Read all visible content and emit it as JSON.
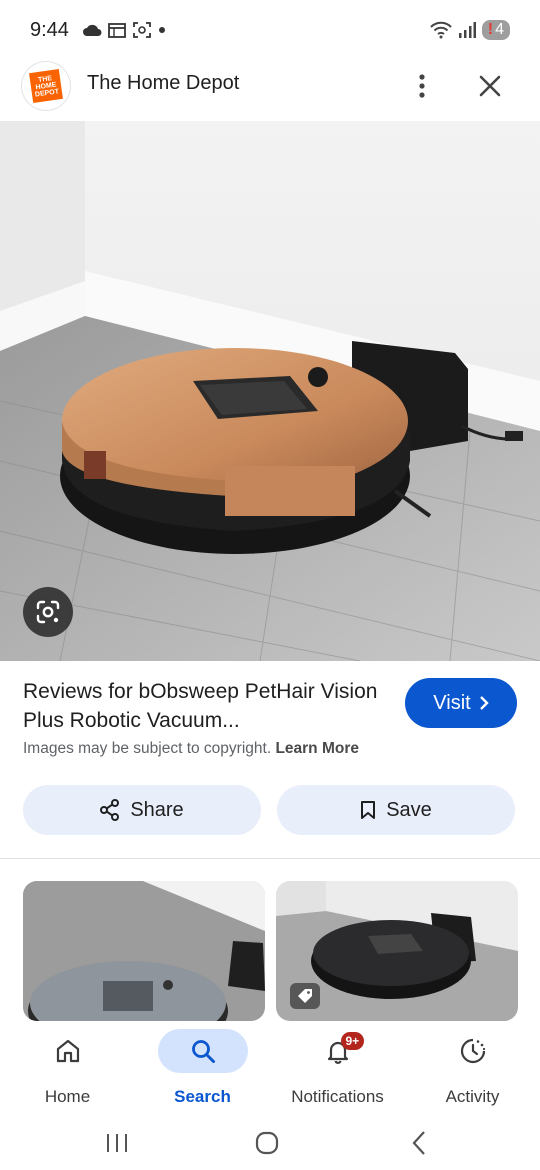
{
  "status": {
    "time": "9:44",
    "battery": "4",
    "battery_alert": "!"
  },
  "header": {
    "site_name": "The Home Depot",
    "logo_text": "THE HOME DEPOT"
  },
  "result": {
    "title": "Reviews for bObsweep PetHair Vision Plus Robotic Vacuum...",
    "visit_label": "Visit",
    "copyright_text": "Images may be subject to copyright.",
    "learn_more_label": "Learn More"
  },
  "actions": {
    "share_label": "Share",
    "save_label": "Save"
  },
  "bottom_nav": {
    "items": [
      {
        "label": "Home",
        "icon": "home-icon",
        "active": false
      },
      {
        "label": "Search",
        "icon": "search-icon",
        "active": true
      },
      {
        "label": "Notifications",
        "icon": "bell-icon",
        "active": false,
        "badge": "9+"
      },
      {
        "label": "Activity",
        "icon": "activity-icon",
        "active": false
      }
    ]
  },
  "colors": {
    "accent": "#0b57d0",
    "pill_bg": "#e8eefa",
    "active_nav_bg": "#d3e3fd",
    "badge": "#b3261e",
    "brand_orange": "#f96302",
    "robot_copper": "#c98c5e"
  }
}
